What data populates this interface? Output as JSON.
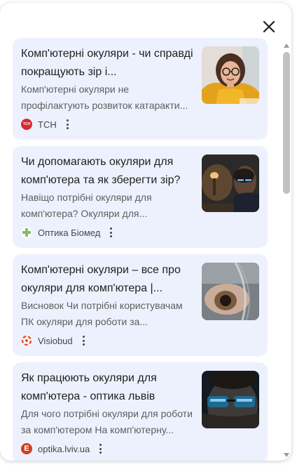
{
  "close_label": "",
  "cards": [
    {
      "title": "Комп'ютерні окуляри - чи справді покращують зір і...",
      "snippet": "Комп'ютерні окуляри не профілактують розвиток катаракти...",
      "source": "ТСН",
      "favicon_text": "ТСН",
      "favicon_color": "#d7282f"
    },
    {
      "title": "Чи допомагають окуляри для комп'ютера та як зберегти зір?",
      "snippet": "Навіщо потрібні окуляри для комп'ютера? Окуляри для...",
      "source": "Оптика Біомед",
      "favicon_color": "#7fbf6a"
    },
    {
      "title": "Комп'ютерні окуляри – все про окуляри для комп'ютера |...",
      "snippet": "Висновок Чи потрібні користувачам ПК окуляри для роботи за...",
      "source": "Visiobud",
      "favicon_color": "#e8542f"
    },
    {
      "title": "Як працюють окуляри для комп'ютера - оптика львів",
      "snippet": "Для чого потрібні окуляри для роботи за комп'ютером На комп'ютерну...",
      "source": "optika.lviv.ua",
      "favicon_text": "E",
      "favicon_color": "#d23d1a"
    }
  ]
}
